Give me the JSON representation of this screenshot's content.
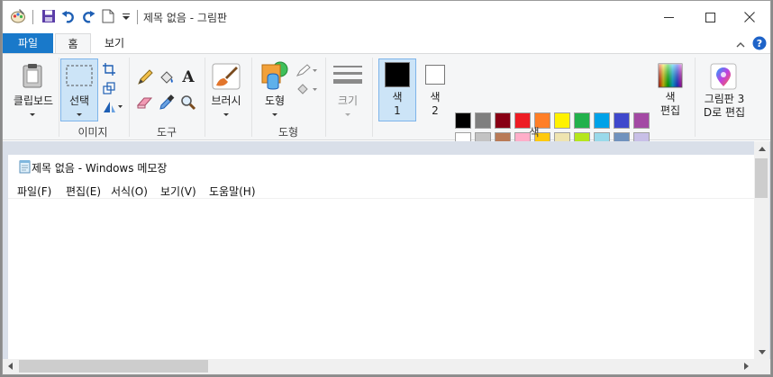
{
  "titlebar": {
    "title": "제목 없음 - 그림판",
    "icons": [
      "paint-app-icon",
      "save-icon",
      "undo-icon",
      "redo-icon",
      "new-icon",
      "customize-dropdown-icon"
    ],
    "controls": [
      "minimize",
      "maximize",
      "close"
    ]
  },
  "tabs": {
    "file": "파일",
    "home": "홈",
    "view": "보기"
  },
  "ribbon": {
    "clipboard": {
      "label": "클립보드"
    },
    "image": {
      "select_label": "선택",
      "group_label": "이미지"
    },
    "tools": {
      "group_label": "도구"
    },
    "brushes": {
      "label": "브러시"
    },
    "shapes": {
      "label": "도형",
      "group_label": "도형"
    },
    "size": {
      "label": "크기"
    },
    "colors": {
      "color1_line1": "색",
      "color1_line2": "1",
      "color2_line1": "색",
      "color2_line2": "2",
      "edit_line1": "색",
      "edit_line2": "편집",
      "group_label": "색",
      "color1_value": "#000000",
      "color2_value": "#ffffff",
      "palette_row1": [
        "#000000",
        "#7f7f7f",
        "#880015",
        "#ed1c24",
        "#ff7f27",
        "#fff200",
        "#22b14c",
        "#00a2e8",
        "#3f48cc",
        "#a349a4"
      ],
      "palette_row2": [
        "#ffffff",
        "#c3c3c3",
        "#b97a57",
        "#ffaec9",
        "#ffc90e",
        "#efe4b0",
        "#b5e61d",
        "#99d9ea",
        "#7092be",
        "#c8bfe7"
      ]
    },
    "paint3d": {
      "line1": "그림판 3",
      "line2": "D로 편집"
    }
  },
  "notepad": {
    "title": "제목 없음 - Windows 메모장",
    "menu": [
      "파일(F)",
      "편집(E)",
      "서식(O)",
      "보기(V)",
      "도움말(H)"
    ]
  }
}
